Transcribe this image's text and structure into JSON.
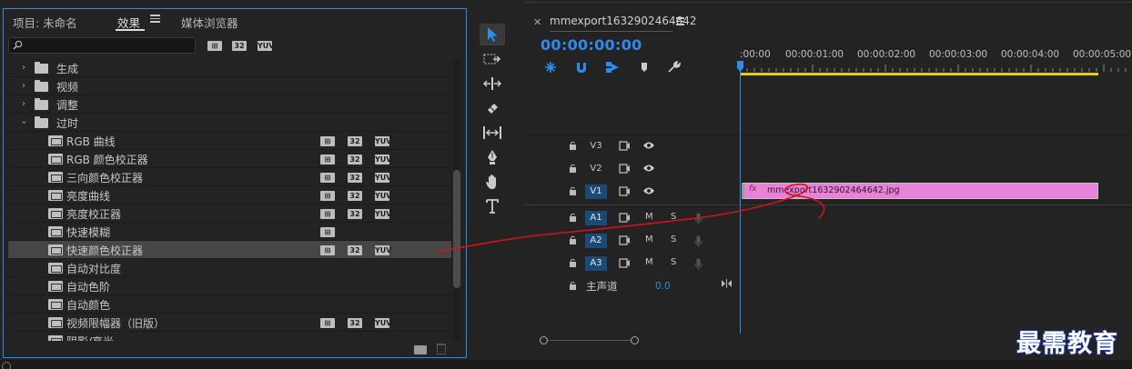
{
  "effects_panel": {
    "tabs": [
      {
        "label": "项目: 未命名"
      },
      {
        "label": "效果"
      },
      {
        "label": "媒体浏览器"
      }
    ],
    "search": {
      "value": "",
      "placeholder": ""
    },
    "filter_badges": [
      "32",
      "YUV"
    ],
    "folders": [
      {
        "label": "生成",
        "expanded": false
      },
      {
        "label": "视频",
        "expanded": false
      },
      {
        "label": "调整",
        "expanded": false
      },
      {
        "label": "过时",
        "expanded": true
      }
    ],
    "effects": [
      {
        "label": "RGB 曲线",
        "badges": [
          "32",
          "YUV"
        ]
      },
      {
        "label": "RGB 颜色校正器",
        "badges": [
          "32",
          "YUV"
        ]
      },
      {
        "label": "三向颜色校正器",
        "badges": [
          "32",
          "YUV"
        ]
      },
      {
        "label": "亮度曲线",
        "badges": [
          "32",
          "YUV"
        ]
      },
      {
        "label": "亮度校正器",
        "badges": [
          "32",
          "YUV"
        ]
      },
      {
        "label": "快速模糊",
        "badges": []
      },
      {
        "label": "快速颜色校正器",
        "badges": [
          "32",
          "YUV"
        ],
        "selected": true
      },
      {
        "label": "自动对比度",
        "badges": []
      },
      {
        "label": "自动色阶",
        "badges": []
      },
      {
        "label": "自动颜色",
        "badges": []
      },
      {
        "label": "视频限幅器（旧版）",
        "badges": [
          "32",
          "YUV"
        ]
      },
      {
        "label": "阴影/高光",
        "badges": []
      }
    ]
  },
  "tools": [
    {
      "icon": "selection-tool-icon",
      "active": true
    },
    {
      "icon": "track-select-icon"
    },
    {
      "icon": "ripple-edit-icon"
    },
    {
      "icon": "razor-icon"
    },
    {
      "icon": "slip-icon"
    },
    {
      "icon": "pen-icon"
    },
    {
      "icon": "hand-icon"
    },
    {
      "icon": "type-icon"
    }
  ],
  "timeline": {
    "sequence_name": "mmexport1632902464642",
    "timecode": "00:00:00:00",
    "ruler_labels": [
      ":00:00",
      "00:00:01:00",
      "00:00:02:00",
      "00:00:03:00",
      "00:00:04:00",
      "00:00:05:00"
    ],
    "video_tracks": [
      "V3",
      "V2",
      "V1"
    ],
    "audio_tracks": [
      "A1",
      "A2",
      "A3"
    ],
    "mute_label": "M",
    "solo_label": "S",
    "master_label": "主声道",
    "master_value": "0.0",
    "clip": {
      "fx": "fx",
      "name": "mmexport1632902464642.jpg"
    }
  },
  "watermark": "最需教育",
  "colors": {
    "accent": "#2d8ceb",
    "clip": "#e882d8",
    "work_area": "#e8d000",
    "annotation": "#d0131a"
  }
}
